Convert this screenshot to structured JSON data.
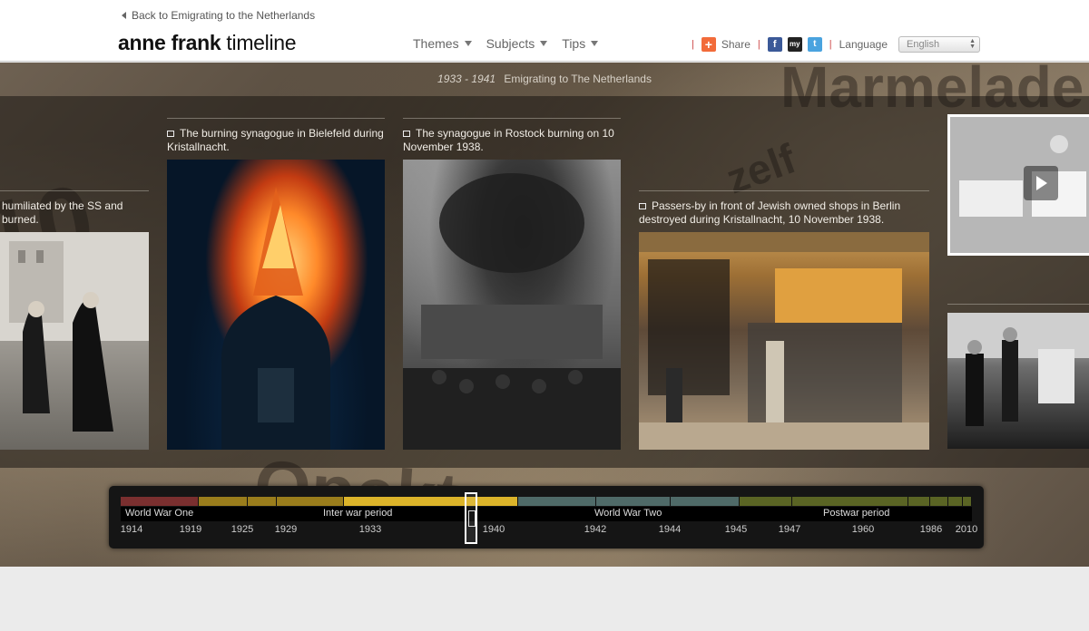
{
  "header": {
    "back_link": "Back to Emigrating to the Netherlands",
    "logo_bold": "anne frank",
    "logo_light": "timeline",
    "nav": [
      {
        "label": "Themes"
      },
      {
        "label": "Subjects"
      },
      {
        "label": "Tips"
      }
    ],
    "share_label": "Share",
    "language_label": "Language",
    "language_value": "English"
  },
  "stage": {
    "period_years": "1933 - 1941",
    "period_title": "Emigrating to The Netherlands",
    "cards": [
      {
        "caption": "humiliated by the SS and burned."
      },
      {
        "caption": "The burning synagogue in Bielefeld during Kristallnacht."
      },
      {
        "caption": "The synagogue in Rostock burning on 10 November 1938."
      },
      {
        "caption": "Passers-by in front of Jewish owned shops in Berlin destroyed during Kristallnacht, 10 November 1938."
      }
    ]
  },
  "timeline": {
    "periods": [
      {
        "label": "World War One",
        "color": "#7a2f2f"
      },
      {
        "label": "Inter war period",
        "color": "#c9a020"
      },
      {
        "label": "World War Two",
        "color": "#4f6a68"
      },
      {
        "label": "Postwar period",
        "color": "#5a6424"
      }
    ],
    "years": [
      "1914",
      "1919",
      "1925",
      "1929",
      "1933",
      "1940",
      "1942",
      "1944",
      "1945",
      "1947",
      "1960",
      "1986",
      "2010"
    ]
  }
}
